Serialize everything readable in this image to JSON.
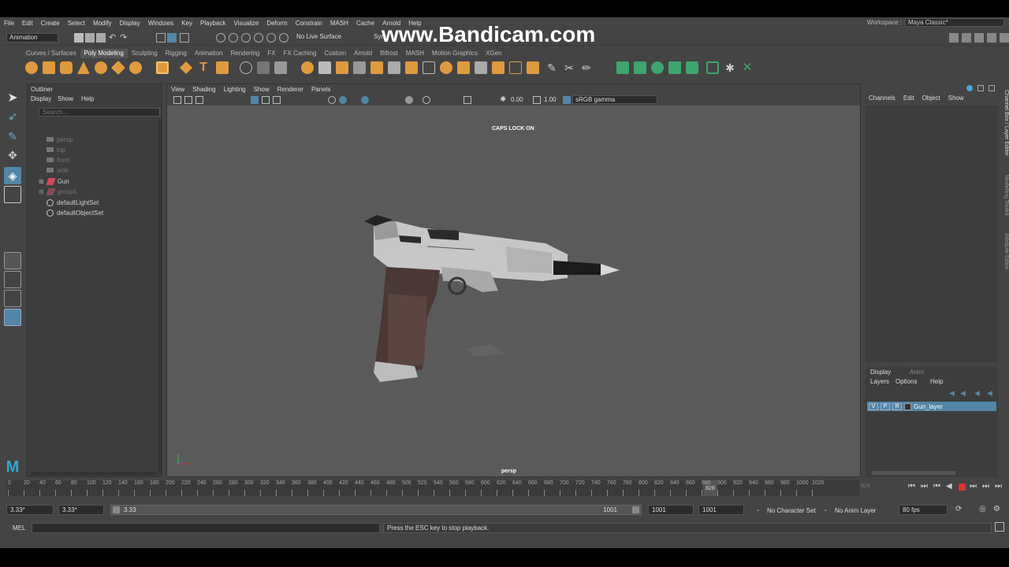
{
  "menus": [
    "File",
    "Edit",
    "Create",
    "Select",
    "Modify",
    "Display",
    "Windows",
    "Key",
    "Playback",
    "Visualize",
    "Deform",
    "Constrain",
    "MASH",
    "Cache",
    "Arnold",
    "Help"
  ],
  "workspace": {
    "label": "Workspace :",
    "value": "Maya Classic*"
  },
  "status": {
    "mode": "Animation",
    "live_surface": "No Live Surface",
    "sym": "Sym"
  },
  "watermark": "www.Bandicam.com",
  "shelf_tabs": [
    "Curves / Surfaces",
    "Poly Modeling",
    "Sculpting",
    "Rigging",
    "Animation",
    "Rendering",
    "FX",
    "FX Caching",
    "Custom",
    "Arnold",
    "Bifrost",
    "MASH",
    "Motion Graphics",
    "XGen"
  ],
  "shelf_active": "Poly Modeling",
  "outliner": {
    "title": "Outliner",
    "menu": [
      "Display",
      "Show",
      "Help"
    ],
    "search_placeholder": "Search...",
    "items": [
      {
        "label": "persp",
        "dim": true
      },
      {
        "label": "top",
        "dim": true
      },
      {
        "label": "front",
        "dim": true
      },
      {
        "label": "side",
        "dim": true
      },
      {
        "label": "Gun",
        "dim": false
      },
      {
        "label": "group1",
        "dim": true
      },
      {
        "label": "defaultLightSet",
        "dim": false
      },
      {
        "label": "defaultObjectSet",
        "dim": false
      }
    ]
  },
  "viewport": {
    "menu": [
      "View",
      "Shading",
      "Lighting",
      "Show",
      "Renderer",
      "Panels"
    ],
    "exposure": "0.00",
    "gamma": "1.00",
    "colorspace": "sRGB gamma",
    "hud_caps": "CAPS LOCK ON",
    "camera": "persp"
  },
  "channel_box": {
    "menu": [
      "Channels",
      "Edit",
      "Object",
      "Show"
    ]
  },
  "side_tabs": [
    "Channel Box / Layer Editor",
    "Modelling Toolkit",
    "Attribute Editor"
  ],
  "layer_editor": {
    "tabs": [
      "Display",
      "Anim"
    ],
    "menu": [
      "Layers",
      "Options",
      "Help"
    ],
    "layer": {
      "v": "V",
      "p": "P",
      "r": "R",
      "name": "Gun_layer"
    }
  },
  "timeline": {
    "ticks": [
      "0",
      "20",
      "40",
      "60",
      "80",
      "100",
      "120",
      "140",
      "160",
      "180",
      "200",
      "220",
      "240",
      "260",
      "280",
      "300",
      "320",
      "340",
      "360",
      "380",
      "400",
      "420",
      "440",
      "460",
      "480",
      "500",
      "520",
      "540",
      "560",
      "580",
      "600",
      "620",
      "640",
      "660",
      "680",
      "700",
      "720",
      "740",
      "760",
      "780",
      "800",
      "820",
      "840",
      "860",
      "880",
      "900",
      "920",
      "940",
      "960",
      "980",
      "1000",
      "1020"
    ],
    "current_frame": "828",
    "end_label": "929"
  },
  "range": {
    "start": "3.33*",
    "anim_start": "3.33*",
    "slider_start": "3.33",
    "slider_end": "1001",
    "anim_end": "1001",
    "end": "1001",
    "character_set": "No Character Set",
    "anim_layer": "No Anim Layer",
    "fps": "80 fps"
  },
  "command": {
    "lang": "MEL",
    "message": "Press the ESC key to stop playback."
  }
}
